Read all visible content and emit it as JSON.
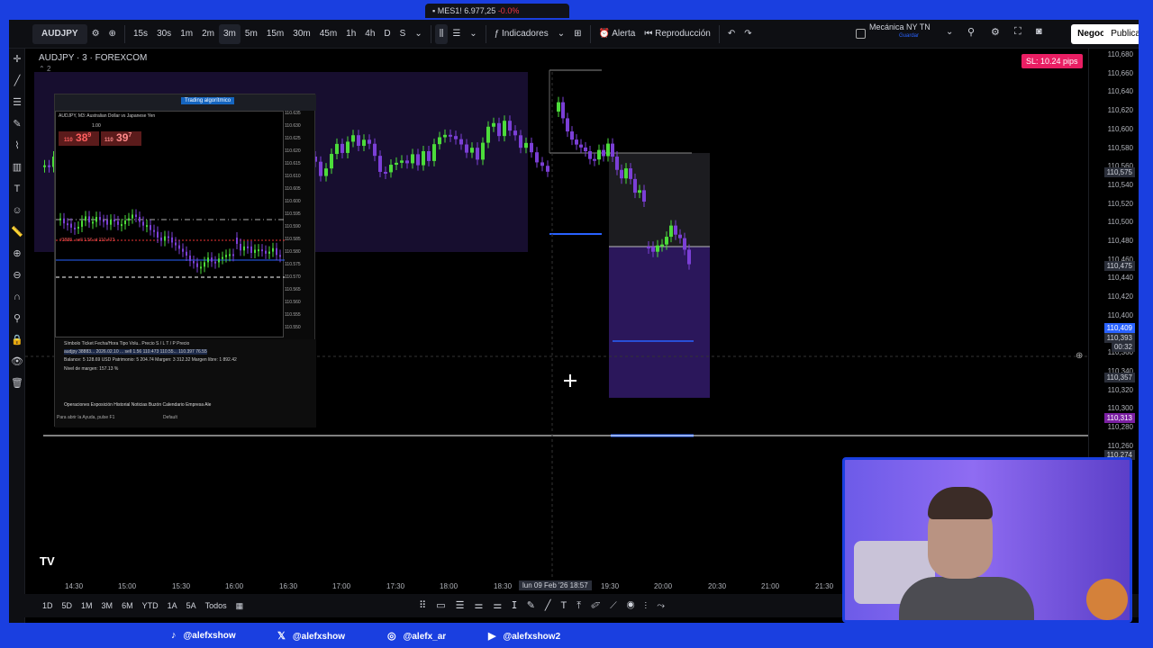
{
  "browser_tab": {
    "symbol": "MES1!",
    "price": "6.977,25",
    "change": "-0.0%"
  },
  "toolbar": {
    "symbol": "AUDJPY",
    "timeframes": [
      "15s",
      "30s",
      "1m",
      "2m",
      "3m",
      "5m",
      "15m",
      "30m",
      "45m",
      "1h",
      "4h",
      "D",
      "S"
    ],
    "active_timeframe": "3m",
    "indicators_label": "Indicadores",
    "alert_label": "Alerta",
    "replay_label": "Reproducción",
    "layout_name": "Mecánica NY TN",
    "layout_sub": "Guardar",
    "trade_button": "Negocie",
    "publish_button": "Publica"
  },
  "chart": {
    "title": "AUDJPY · 3 · FOREXCOM",
    "indicator_count": "2",
    "sl_badge": "SL: 10.24 pips",
    "price_ticks": [
      "110,680",
      "110,660",
      "110,640",
      "110,620",
      "110,600",
      "110,580",
      "110,560",
      "110,540",
      "110,520",
      "110,500",
      "110,480",
      "110,460",
      "110,440",
      "110,420",
      "110,400",
      "110,380",
      "110,360",
      "110,340",
      "110,320",
      "110,300",
      "110,280",
      "110,260"
    ],
    "price_labels": {
      "top_line": "110,575",
      "mid_line": "110,475",
      "last_price": "110,409",
      "last_sub": "110,393",
      "countdown": "00:32",
      "crosshair": "110,357",
      "purple_line": "110,313",
      "bottom_line": "110,274"
    },
    "time_ticks": [
      "14:30",
      "15:00",
      "15:30",
      "16:00",
      "16:30",
      "17:00",
      "17:30",
      "18:00",
      "18:30",
      "19:30",
      "20:00",
      "20:30",
      "21:00",
      "21:30"
    ],
    "crosshair_time": "lun 09 Feb '26  18:57"
  },
  "bottom_bar": {
    "ranges": [
      "1D",
      "5D",
      "1M",
      "3M",
      "6M",
      "YTD",
      "1A",
      "5A",
      "Todos"
    ]
  },
  "mt5": {
    "algo_button": "Trading algorítmico",
    "header": "AUDJPY, M3: Australian Dollar vs Japanese Yen",
    "sell_price": "38",
    "sell_prefix": "110",
    "sell_sup": "9",
    "buy_price": "39",
    "buy_prefix": "110",
    "buy_sup": "7",
    "lot": "1.00",
    "order_label": "#3888.. sell 1.56 at 110.473",
    "terminal_headers": "Símbolo   Ticket   Fecha/Hora   Tipo   Volu..   Precio   S / L   T / P   Precio",
    "terminal_row": "audjpy    38883...  2026.02.10 ...  sell   1.56   110.473  110.55...  110.397  76.55",
    "balance_row": "Balance: 5 128.69 USD  Patrimonio: 5 204.74  Margen: 3 312.32  Margen libre: 1 892.42",
    "margin_level": "Nivel de margen: 157.13 %",
    "tabs": "Operaciones   Exposición   Historial   Noticias   Buzón   Calendario   Empresa   Ale",
    "status": "Para abrir la Ayuda, pulse F1",
    "status_right": "Default",
    "price_axis": [
      "110.635",
      "110.630",
      "110.625",
      "110.620",
      "110.615",
      "110.610",
      "110.605",
      "110.600",
      "110.595",
      "110.590",
      "110.585",
      "110.580",
      "110.575",
      "110.570",
      "110.565",
      "110.560",
      "110.555",
      "110.550"
    ]
  },
  "social": [
    {
      "icon": "tiktok-icon",
      "handle": "@alefxshow"
    },
    {
      "icon": "x-icon",
      "handle": "@alefxshow"
    },
    {
      "icon": "instagram-icon",
      "handle": "@alefx_ar"
    },
    {
      "icon": "youtube-icon",
      "handle": "@alefxshow2"
    }
  ],
  "colors": {
    "brand_blue": "#1a3fe0",
    "bull": "#4cdc3a",
    "bear": "#7b3fd6",
    "sl_badge": "#e91e63",
    "last_price": "#2962ff"
  }
}
